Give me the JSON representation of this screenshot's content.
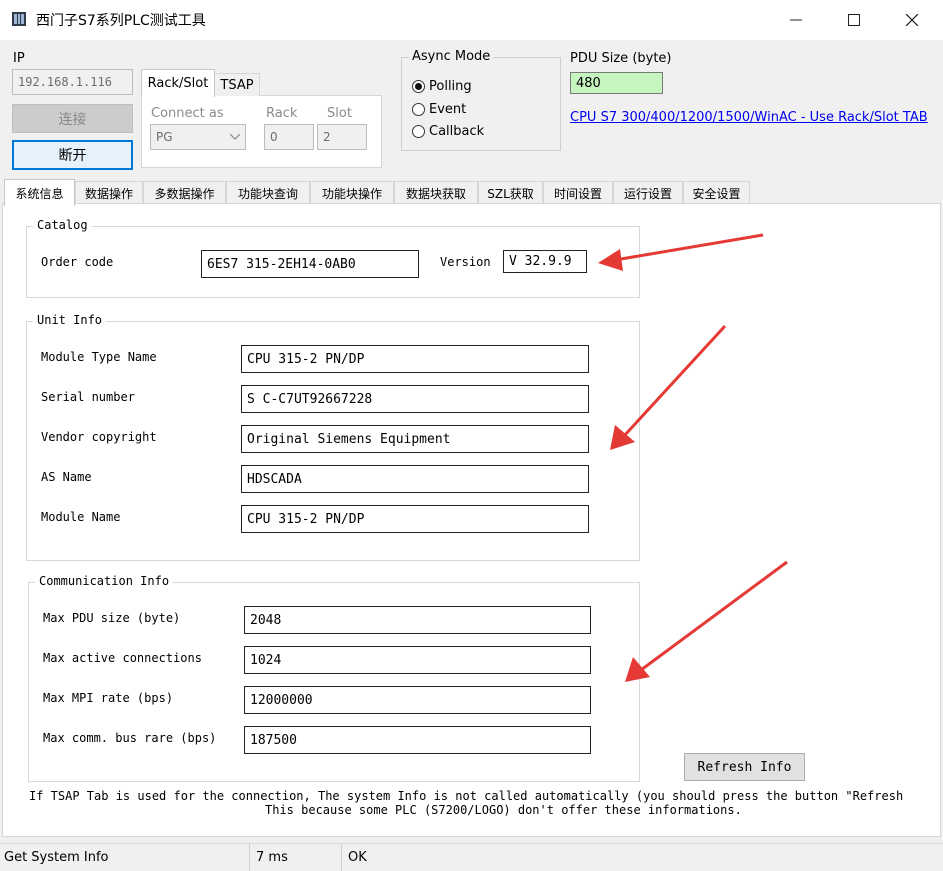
{
  "window": {
    "title": "西门子S7系列PLC测试工具",
    "controls": {
      "minimize": "—",
      "maximize": "☐",
      "close": "✕"
    }
  },
  "connection": {
    "ip_label": "IP",
    "ip_value": "192.168.1.116",
    "connect_label": "连接",
    "disconnect_label": "断开"
  },
  "conn_tabs": {
    "tabs": [
      "Rack/Slot",
      "TSAP"
    ],
    "connect_as_label": "Connect as",
    "connect_as_value": "PG",
    "rack_label": "Rack",
    "rack_value": "0",
    "slot_label": "Slot",
    "slot_value": "2"
  },
  "async_mode": {
    "label": "Async Mode",
    "options": [
      "Polling",
      "Event",
      "Callback"
    ],
    "selected": "Polling"
  },
  "pdu": {
    "label": "PDU Size (byte)",
    "value": "480",
    "value_bg": "#c6f5c0",
    "link": "CPU S7 300/400/1200/1500/WinAC - Use Rack/Slot TAB"
  },
  "main_tabs": [
    "系统信息",
    "数据操作",
    "多数据操作",
    "功能块查询",
    "功能块操作",
    "数据块获取",
    "SZL获取",
    "时间设置",
    "运行设置",
    "安全设置"
  ],
  "active_tab": "系统信息",
  "catalog": {
    "title": "Catalog",
    "order_code_label": "Order code",
    "order_code": "6ES7 315-2EH14-0AB0",
    "version_label": "Version",
    "version": "V 32.9.9"
  },
  "unit_info": {
    "title": "Unit Info",
    "fields": [
      {
        "label": "Module Type Name",
        "value": "CPU 315-2 PN/DP"
      },
      {
        "label": "Serial number",
        "value": "S C-C7UT92667228"
      },
      {
        "label": "Vendor copyright",
        "value": "Original Siemens Equipment"
      },
      {
        "label": "AS Name",
        "value": "HDSCADA"
      },
      {
        "label": "Module Name",
        "value": "CPU 315-2 PN/DP"
      }
    ]
  },
  "comm_info": {
    "title": "Communication Info",
    "fields": [
      {
        "label": "Max PDU size (byte)",
        "value": "2048"
      },
      {
        "label": "Max active connections",
        "value": "1024"
      },
      {
        "label": "Max MPI rate (bps)",
        "value": "12000000"
      },
      {
        "label": "Max comm. bus rare (bps)",
        "value": "187500"
      }
    ]
  },
  "refresh_label": "Refresh Info",
  "note": {
    "line1": "If TSAP Tab is used for the connection, The system Info is not called automatically (you should press the button \"Refresh",
    "line2": "This because some PLC (S7200/LOGO) don't offer these informations."
  },
  "status": {
    "message": "Get System Info",
    "time": "7 ms",
    "result": "OK"
  },
  "annotation_color": "#e53935"
}
